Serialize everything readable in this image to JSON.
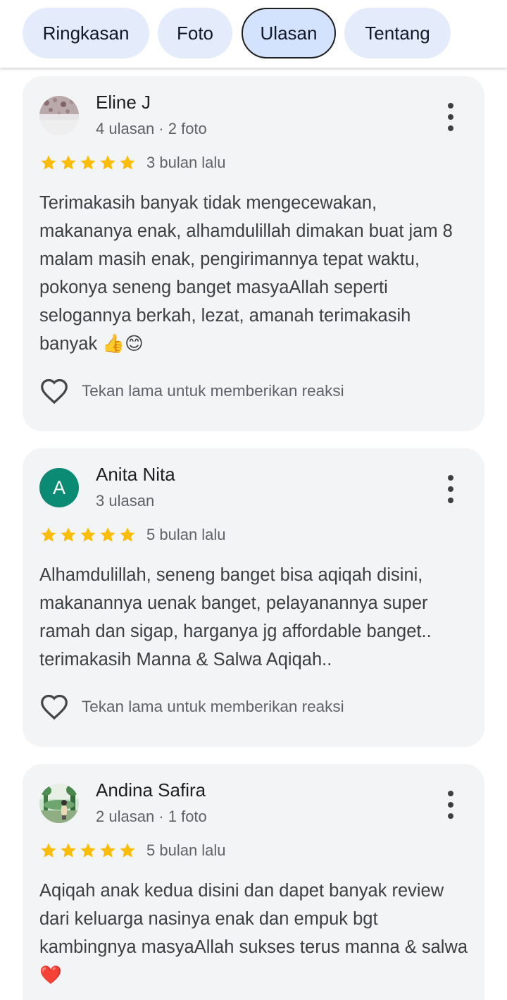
{
  "tabs": [
    {
      "label": "Ringkasan",
      "active": false
    },
    {
      "label": "Foto",
      "active": false
    },
    {
      "label": "Ulasan",
      "active": true
    },
    {
      "label": "Tentang",
      "active": false
    }
  ],
  "reviews": [
    {
      "author": "Eline J",
      "meta": "4 ulasan · 2 foto",
      "rating": 5,
      "date": "3 bulan lalu",
      "text": "Terimakasih banyak tidak mengecewakan, makananya enak, alhamdulillah dimakan buat jam 8 malam masih enak, pengirimannya tepat waktu, pokonya seneng banget masyaAllah seperti selogannya berkah, lezat, amanah terimakasih banyak 👍😊",
      "reaction_label": "Tekan lama untuk memberikan reaksi"
    },
    {
      "author": "Anita Nita",
      "avatar_letter": "A",
      "meta": "3 ulasan",
      "rating": 5,
      "date": "5 bulan lalu",
      "text": "Alhamdulillah, seneng banget bisa aqiqah disini, makanannya uenak banget, pelayanannya super ramah dan sigap, harganya jg affordable banget.. terimakasih Manna & Salwa Aqiqah..",
      "reaction_label": "Tekan lama untuk memberikan reaksi"
    },
    {
      "author": "Andina Safira",
      "meta": "2 ulasan · 1 foto",
      "rating": 5,
      "date": "5 bulan lalu",
      "text": "Aqiqah anak kedua disini dan dapet banyak review dari keluarga nasinya enak dan empuk bgt kambingnya masyaAllah sukses terus manna & salwa❤️"
    }
  ],
  "colors": {
    "star": "#fbbc04",
    "active_tab_border": "#1f1f1f",
    "tab_bg": "#e4ecfb",
    "card_bg": "#f3f4f6",
    "avatar_letter_bg": "#0b8a74"
  },
  "icons": {
    "more": "more-vert-icon",
    "star": "star-icon",
    "heart": "heart-outline-icon"
  }
}
